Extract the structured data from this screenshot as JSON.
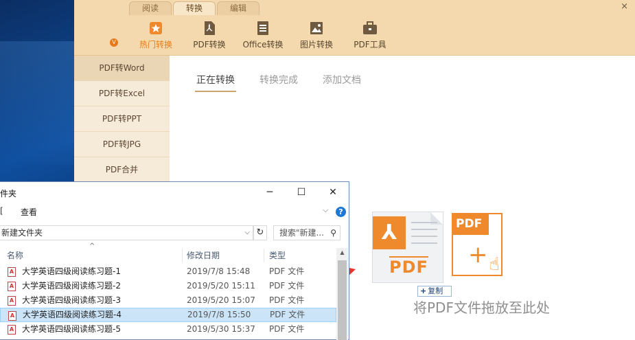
{
  "app": {
    "tabs": [
      "阅读",
      "转换",
      "编辑"
    ],
    "active_tab": 1,
    "close_glyph": "×",
    "tools": [
      {
        "label": "热门转换",
        "icon": "star-icon",
        "active": true
      },
      {
        "label": "PDF转换",
        "icon": "pdf-icon",
        "active": false
      },
      {
        "label": "Office转换",
        "icon": "document-icon",
        "active": false
      },
      {
        "label": "图片转换",
        "icon": "image-icon",
        "active": false
      },
      {
        "label": "PDF工具",
        "icon": "briefcase-icon",
        "active": false
      }
    ],
    "sidebar": [
      "PDF转Word",
      "PDF转Excel",
      "PDF转PPT",
      "PDF转JPG",
      "PDF合并"
    ],
    "sidebar_active": 0,
    "content_tabs": [
      "正在转换",
      "转换完成",
      "添加文档"
    ],
    "content_active": 0,
    "drop_text": "将PDF文件拖放至此处",
    "copy_badge": "复制",
    "pdf_label": "PDF",
    "colors": {
      "accent": "#ef8a2c",
      "ribbon": "#f3d9ad",
      "sidebar": "#f6ead8"
    }
  },
  "explorer": {
    "title": "件夹",
    "ribbon_partial": "[",
    "ribbon_view": "查看",
    "address": "新建文件夹",
    "search_placeholder": "搜索\"新建...",
    "columns": [
      "名称",
      "修改日期",
      "类型"
    ],
    "files": [
      {
        "name": "大学英语四级阅读练习题-1",
        "date": "2019/7/8 15:48",
        "type": "PDF 文件",
        "selected": false
      },
      {
        "name": "大学英语四级阅读练习题-2",
        "date": "2019/5/20 15:11",
        "type": "PDF 文件",
        "selected": false
      },
      {
        "name": "大学英语四级阅读练习题-3",
        "date": "2019/5/20 15:07",
        "type": "PDF 文件",
        "selected": false
      },
      {
        "name": "大学英语四级阅读练习题-4",
        "date": "2019/7/8 15:50",
        "type": "PDF 文件",
        "selected": true
      },
      {
        "name": "大学英语四级阅读练习题-5",
        "date": "2019/5/30 15:37",
        "type": "PDF 文件",
        "selected": false
      }
    ]
  }
}
